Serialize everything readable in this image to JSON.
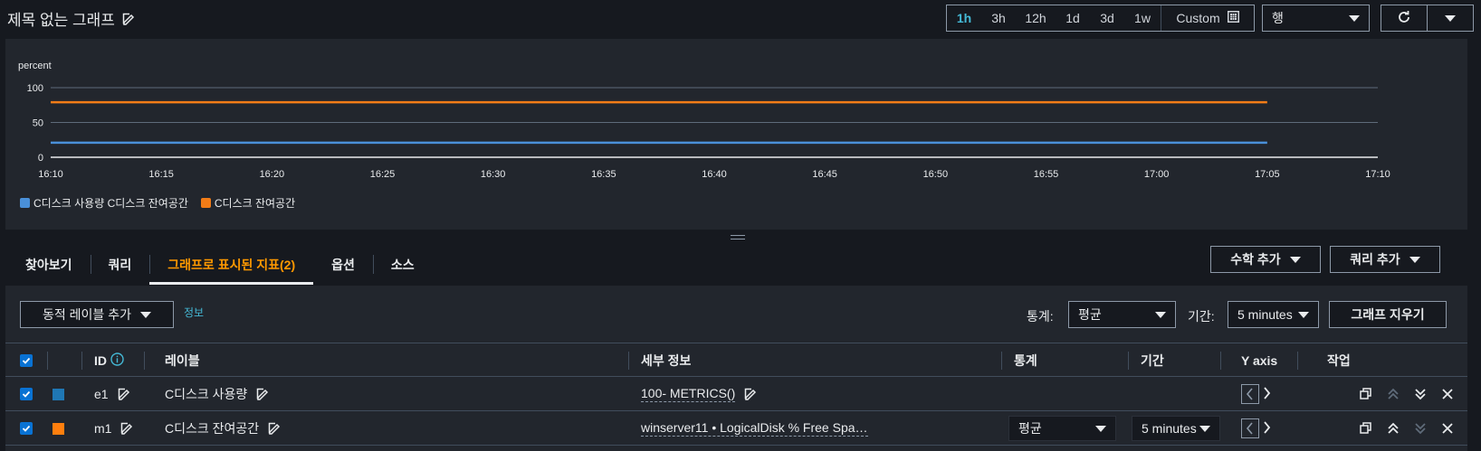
{
  "header": {
    "title": "제목 없는 그래프",
    "ranges": [
      "1h",
      "3h",
      "12h",
      "1d",
      "3d",
      "1w"
    ],
    "active_range": "1h",
    "custom_label": "Custom",
    "view_select": "행"
  },
  "chart_data": {
    "type": "line",
    "ylabel": "percent",
    "y_ticks": [
      0,
      50,
      100
    ],
    "ylim": [
      0,
      100
    ],
    "x_ticks": [
      "16:10",
      "16:15",
      "16:20",
      "16:25",
      "16:30",
      "16:35",
      "16:40",
      "16:45",
      "16:50",
      "16:55",
      "17:00",
      "17:05",
      "17:10"
    ],
    "series": [
      {
        "name": "C디스크 사용량 C디스크 잔여공간",
        "color": "#4a90d9",
        "x": [
          "16:10",
          "17:05"
        ],
        "values": [
          21,
          21
        ]
      },
      {
        "name": "C디스크 잔여공간",
        "color": "#f27c17",
        "x": [
          "16:10",
          "17:05"
        ],
        "values": [
          79,
          79
        ]
      }
    ]
  },
  "tabs": [
    {
      "label": "찾아보기"
    },
    {
      "label": "쿼리"
    },
    {
      "label": "그래프로 표시된 지표(2)",
      "active": true
    },
    {
      "label": "옵션"
    },
    {
      "label": "소스"
    }
  ],
  "actions": {
    "add_math": "수학 추가",
    "add_query": "쿼리 추가"
  },
  "toolbar": {
    "dynamic_label_btn": "동적 레이블 추가",
    "info": "정보",
    "stat_label": "통계:",
    "stat_value": "평균",
    "period_label": "기간:",
    "period_value": "5 minutes",
    "clear_graph": "그래프 지우기"
  },
  "table": {
    "headers": {
      "id": "ID",
      "label": "레이블",
      "details": "세부 정보",
      "stat": "통계",
      "period": "기간",
      "yaxis": "Y axis",
      "actions": "작업"
    },
    "rows": [
      {
        "id": "e1",
        "label": "C디스크 사용량",
        "details": "100- METRICS()",
        "stat": "",
        "period": "",
        "color": "#1f77b4"
      },
      {
        "id": "m1",
        "label": "C디스크 잔여공간",
        "details": "winserver11 • LogicalDisk % Free Spa…",
        "stat": "평균",
        "period": "5 minutes",
        "color": "#ff7f0e"
      }
    ]
  }
}
